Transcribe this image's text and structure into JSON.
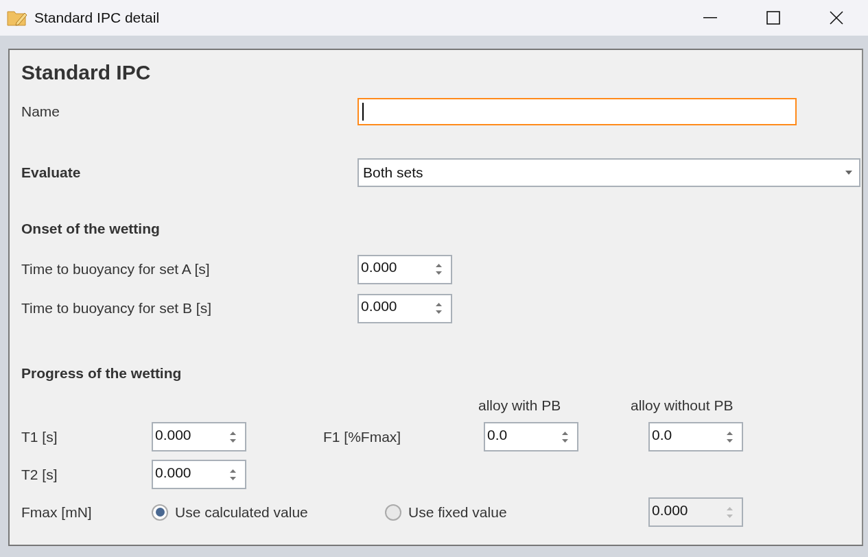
{
  "window": {
    "title": "Standard IPC detail"
  },
  "heading": "Standard IPC",
  "name_field": {
    "label": "Name",
    "focused": true
  },
  "evaluate": {
    "label": "Evaluate",
    "value": "Both sets"
  },
  "onset": {
    "title": "Onset of the wetting",
    "rows": [
      {
        "label": "Time to buoyancy for set A [s]",
        "value": "0.000"
      },
      {
        "label": "Time to buoyancy for set B [s]",
        "value": "0.000"
      }
    ]
  },
  "progress": {
    "title": "Progress of the wetting",
    "columns": [
      "alloy with PB",
      "alloy without PB"
    ],
    "t1": {
      "label": "T1 [s]",
      "value": "0.000"
    },
    "f1": {
      "label": "F1 [%Fmax]",
      "values": [
        "0.0",
        "0.0"
      ]
    },
    "t2": {
      "label": "T2 [s]",
      "value": "0.000"
    },
    "fmax": {
      "label": "Fmax [mN]",
      "options": [
        {
          "label": "Use calculated value",
          "selected": true
        },
        {
          "label": "Use fixed value",
          "selected": false
        }
      ],
      "fixed_value": {
        "value": "0.000",
        "disabled": true
      }
    }
  }
}
